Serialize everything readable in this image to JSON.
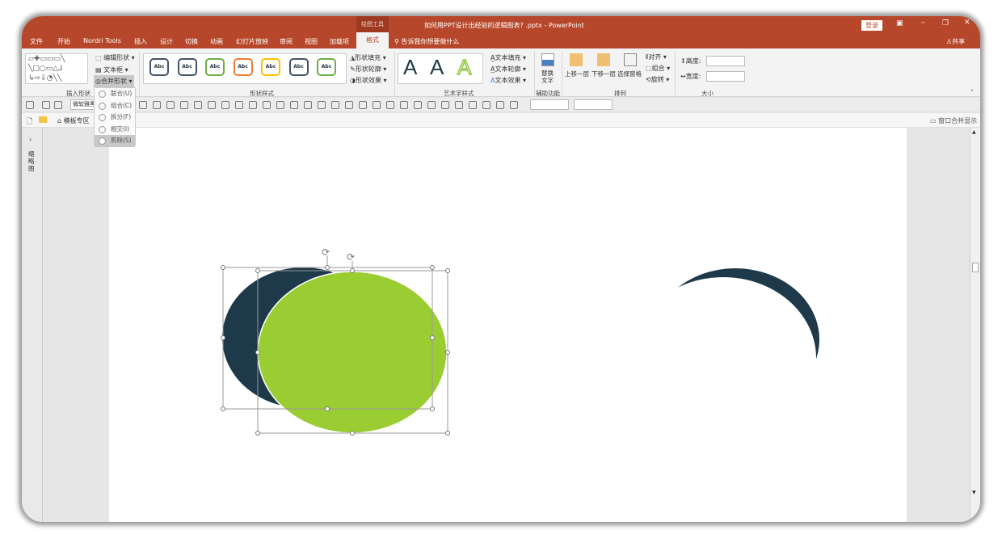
{
  "window": {
    "title": "如何用PPT设计出经验的逻辑图表? .pptx  -  PowerPoint",
    "context_tab": "绘图工具",
    "login": "登录",
    "share": "共享"
  },
  "tabs": [
    "文件",
    "开始",
    "Nordri Tools",
    "插入",
    "设计",
    "切换",
    "动画",
    "幻灯片放映",
    "审阅",
    "视图",
    "加载项"
  ],
  "active_tab": "格式",
  "tell_me": "告诉我你想要做什么",
  "ribbon": {
    "insert_shapes": {
      "label": "插入形状",
      "edit_shape": "编辑形状",
      "text_box": "文本框",
      "merge_shapes": "合并形状"
    },
    "shape_styles": {
      "label": "形状样式",
      "sample": "Abc",
      "fill": "形状填充",
      "outline": "形状轮廓",
      "effects": "形状效果",
      "swatches": [
        "#44546a",
        "#44546a",
        "#70ad47",
        "#ed7d31",
        "#ffc000",
        "#44546a",
        "#70ad47"
      ]
    },
    "wordart": {
      "label": "艺术字样式",
      "glyph": "A",
      "text_fill": "文本填充",
      "text_outline": "文本轮廓",
      "text_effects": "文本效果"
    },
    "accessibility": {
      "label": "辅助功能",
      "alt_text": "替换文字"
    },
    "arrange": {
      "label": "排列",
      "forward": "上移一层",
      "backward": "下移一层",
      "selection_pane": "选择窗格",
      "align": "对齐",
      "group": "组合",
      "rotate": "旋转"
    },
    "size": {
      "label": "大小",
      "height": "高度:",
      "width": "宽度:"
    }
  },
  "merge_menu": {
    "items": [
      "联合(U)",
      "组合(C)",
      "拆分(F)",
      "相交(I)",
      "剪除(S)"
    ],
    "selected": "剪除(S)"
  },
  "toolbar": {
    "font": "微软雅黑",
    "template": "模板专区",
    "merge_window": "窗口合并显示"
  },
  "left_pane": {
    "label": "缩略图"
  },
  "colors": {
    "accent": "#B7472A",
    "dark_shape": "#1E3A4A",
    "green_shape": "#9ACD32"
  }
}
